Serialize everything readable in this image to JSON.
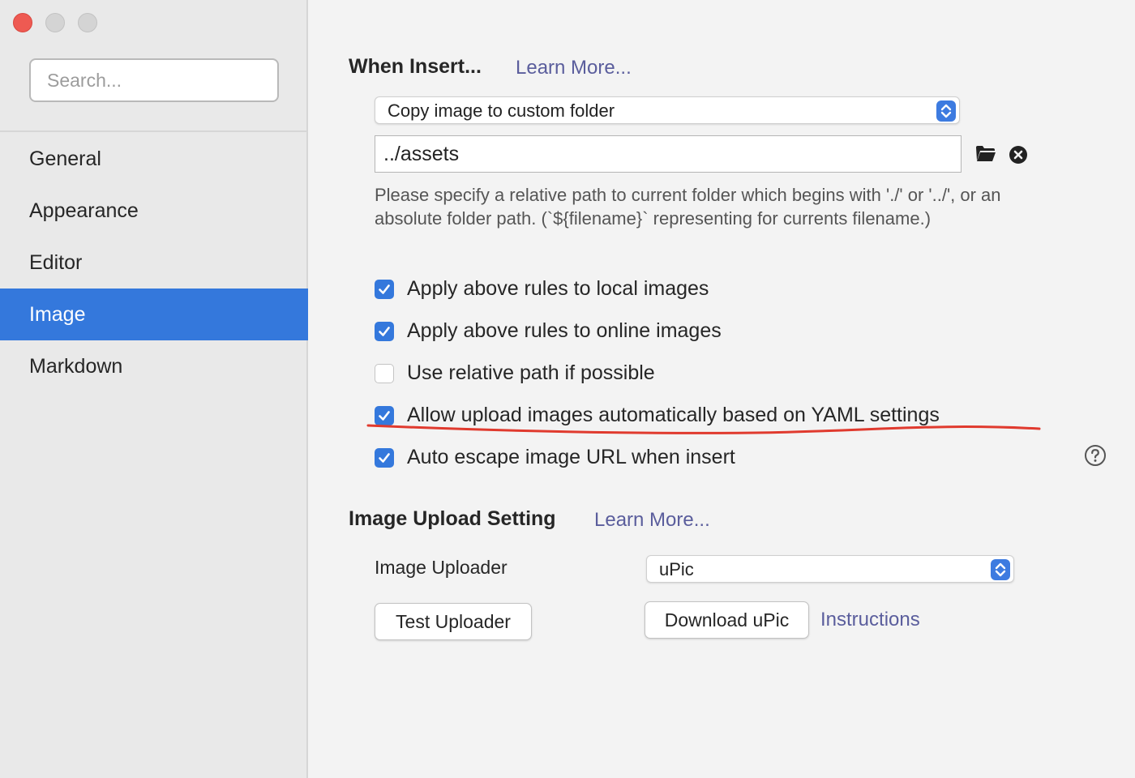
{
  "sidebar": {
    "search_placeholder": "Search...",
    "items": [
      {
        "label": "General"
      },
      {
        "label": "Appearance"
      },
      {
        "label": "Editor"
      },
      {
        "label": "Image"
      },
      {
        "label": "Markdown"
      }
    ],
    "active_item": "Image"
  },
  "when_insert": {
    "title": "When Insert...",
    "learn_more": "Learn More...",
    "action_select": "Copy image to custom folder",
    "path_value": "../assets",
    "folder_icon": "folder-icon",
    "clear_icon": "clear-icon",
    "help_text": "Please specify a relative path to current folder which begins with './' or '../', or an absolute folder path. (`${filename}` representing for currents filename.)"
  },
  "options": [
    {
      "label": "Apply above rules to local images",
      "checked": true
    },
    {
      "label": "Apply above rules to online images",
      "checked": true
    },
    {
      "label": "Use relative path if possible",
      "checked": false
    },
    {
      "label": "Allow upload images automatically based on YAML settings",
      "checked": true
    },
    {
      "label": "Auto escape image URL when insert",
      "checked": true
    }
  ],
  "upload": {
    "title": "Image Upload Setting",
    "learn_more": "Learn More...",
    "uploader_label": "Image Uploader",
    "uploader_value": "uPic",
    "test_button": "Test Uploader",
    "download_button": "Download uPic",
    "instructions_link": "Instructions"
  },
  "colors": {
    "accent": "#3478dc",
    "link": "#5a5d9c",
    "annotation": "#e03a2e",
    "close_dot": "#ee5a52"
  }
}
